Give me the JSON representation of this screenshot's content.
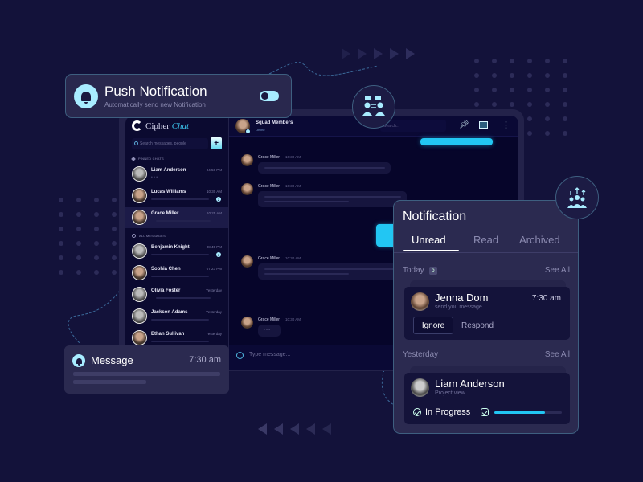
{
  "push_notification": {
    "title": "Push Notification",
    "subtitle": "Automatically send new Notification",
    "toggle_on": true,
    "icon": "bell-icon"
  },
  "app": {
    "brand_primary": "Cipher",
    "brand_accent": "Chat",
    "search_placeholder": "Search messages, people",
    "add_label": "+",
    "pinned_label": "PINNED CHATS",
    "all_label": "ALL MESSAGES",
    "pinned": [
      {
        "name": "Liam Anderson",
        "time": "04:50 PM",
        "preview": "• • •"
      },
      {
        "name": "Lucas Williams",
        "time": "10:30 AM",
        "badge": "2"
      },
      {
        "name": "Grace Miller",
        "time": "10:25 AM",
        "active": true
      }
    ],
    "all": [
      {
        "name": "Benjamin Knight",
        "time": "08:45 PM",
        "badge": "1"
      },
      {
        "name": "Sophia Chen",
        "time": "07:23 PM"
      },
      {
        "name": "Olivia Foster",
        "time": "Yesterday"
      },
      {
        "name": "Jackson Adams",
        "time": "Yesterday"
      },
      {
        "name": "Ethan Sullivan",
        "time": "Yesterday"
      }
    ]
  },
  "chat": {
    "title": "Squad Members",
    "status": "Online",
    "search_placeholder": "Search...",
    "messages": [
      {
        "sender": "Grace Miller",
        "time": "10:30 AM"
      },
      {
        "sender": "Grace Miller",
        "time": "10:30 AM"
      },
      {
        "sender": "Grace Miller",
        "time": "10:30 AM"
      },
      {
        "sender": "Grace Miller",
        "time": "10:30 AM",
        "typing": "• • •"
      }
    ],
    "composer_placeholder": "Type message..."
  },
  "notification_panel": {
    "title": "Notification",
    "tabs": [
      {
        "label": "Unread",
        "active": true
      },
      {
        "label": "Read"
      },
      {
        "label": "Archived"
      }
    ],
    "today": {
      "label": "Today",
      "count": "5",
      "see_all": "See All"
    },
    "today_item": {
      "name": "Jenna Dom",
      "subtitle": "send you message",
      "time": "7:30 am",
      "ignore_label": "Ignore",
      "respond_label": "Respond"
    },
    "yesterday": {
      "label": "Yesterday",
      "see_all": "See All"
    },
    "yesterday_item": {
      "name": "Liam Anderson",
      "subtitle": "Project view",
      "status": "In Progress",
      "progress_percent": 75
    }
  },
  "message_toast": {
    "title": "Message",
    "time": "7:30 am"
  },
  "colors": {
    "background": "#13123a",
    "accent": "#22c6f3",
    "accent_light": "#a8ecff",
    "card": "#2b2a50"
  }
}
